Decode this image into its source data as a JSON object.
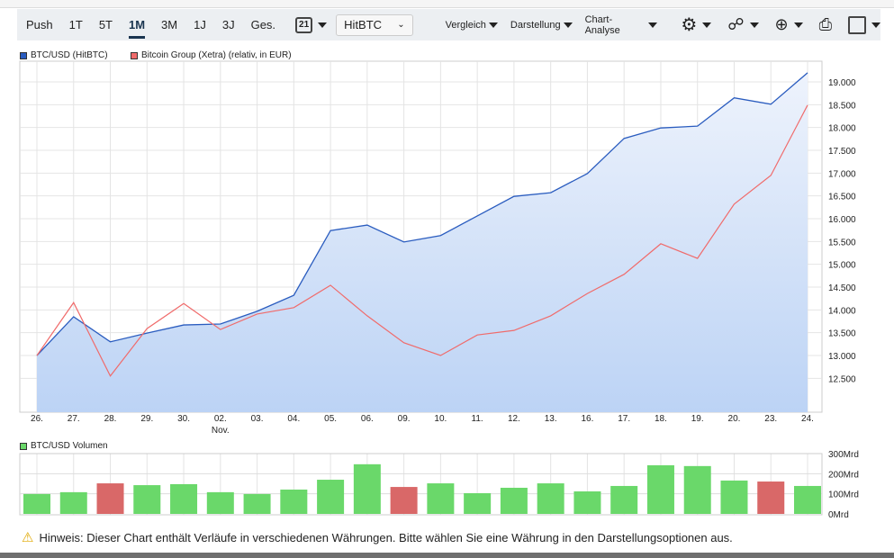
{
  "toolbar": {
    "ranges": [
      "Push",
      "1T",
      "5T",
      "1M",
      "3M",
      "1J",
      "3J",
      "Ges."
    ],
    "active": "1M",
    "calendar_label": "21",
    "exchange": "HitBTC",
    "menus": [
      "Vergleich",
      "Darstellung",
      "Chart-Analyse"
    ]
  },
  "legend": {
    "series1": "BTC/USD (HitBTC)",
    "series2": "Bitcoin Group (Xetra) (relativ, in EUR)",
    "volume": "BTC/USD Volumen"
  },
  "colors": {
    "btc": "#2a5cbf",
    "bitcoin_group": "#f06b6b",
    "vol_up": "#6ad86a",
    "vol_down": "#d96868"
  },
  "note": "Hinweis: Dieser Chart enthält Verläufe in verschiedenen Währungen. Bitte wählen Sie eine Währung in den Darstellungsoptionen aus.",
  "chart_data": [
    {
      "type": "area",
      "categories": [
        "26.",
        "27.",
        "28.",
        "29.",
        "30.",
        "02.",
        "03.",
        "04.",
        "05.",
        "06.",
        "09.",
        "10.",
        "11.",
        "12.",
        "13.",
        "16.",
        "17.",
        "18.",
        "19.",
        "20.",
        "23.",
        "24."
      ],
      "month_label": "Nov.",
      "y_ticks": [
        "19.000",
        "18.500",
        "18.000",
        "17.500",
        "17.000",
        "16.500",
        "16.000",
        "15.500",
        "15.000",
        "14.500",
        "14.000",
        "13.500",
        "13.000",
        "12.500"
      ],
      "ylim": [
        12000,
        19400
      ],
      "series": [
        {
          "name": "BTC/USD (HitBTC)",
          "values": [
            13000,
            13850,
            13300,
            13490,
            13670,
            13690,
            13970,
            14320,
            15740,
            15860,
            15490,
            15630,
            16060,
            16490,
            16570,
            16990,
            17760,
            17990,
            18030,
            18650,
            18510,
            19200
          ]
        },
        {
          "name": "Bitcoin Group (Xetra) (relativ, in EUR)",
          "values": [
            13000,
            14160,
            12550,
            13590,
            14140,
            13570,
            13910,
            14050,
            14540,
            13870,
            13280,
            13000,
            13450,
            13550,
            13870,
            14360,
            14780,
            15450,
            15130,
            16320,
            16950,
            18490
          ]
        }
      ]
    },
    {
      "type": "bar",
      "title": "BTC/USD Volumen",
      "y_ticks": [
        "300Mrd",
        "200Mrd",
        "100Mrd",
        "0Mrd"
      ],
      "ylim": [
        0,
        300
      ],
      "values": [
        99,
        108,
        152,
        143,
        148,
        108,
        99,
        121,
        170,
        247,
        134,
        152,
        103,
        130,
        152,
        112,
        139,
        242,
        238,
        166,
        161,
        139
      ],
      "direction": [
        "up",
        "up",
        "down",
        "up",
        "up",
        "up",
        "up",
        "up",
        "up",
        "up",
        "down",
        "up",
        "up",
        "up",
        "up",
        "up",
        "up",
        "up",
        "up",
        "up",
        "down",
        "up"
      ]
    }
  ]
}
